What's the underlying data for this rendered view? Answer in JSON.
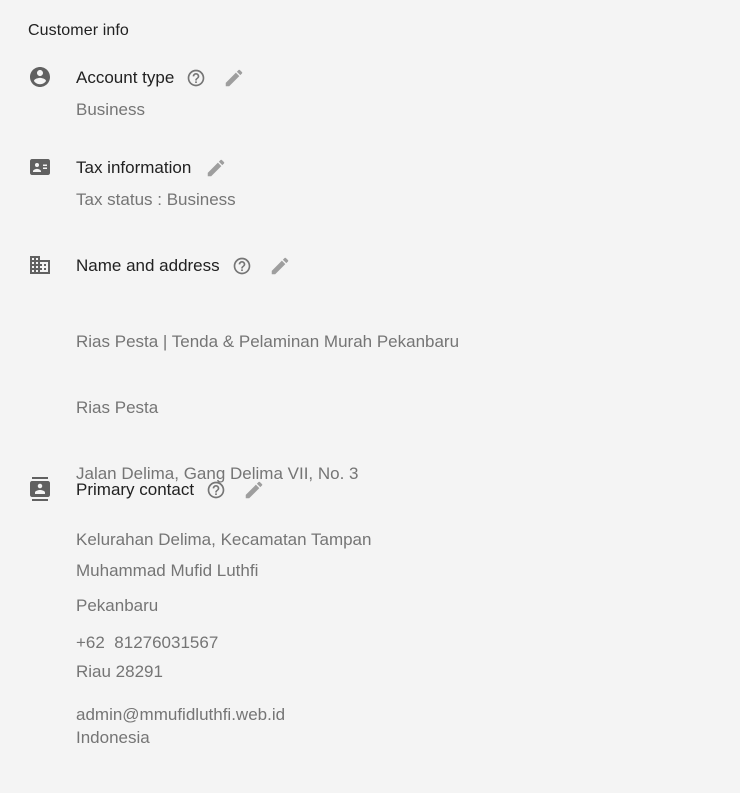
{
  "title": "Customer info",
  "account_type": {
    "icon": "account-circle-icon",
    "label": "Account type",
    "value": "Business"
  },
  "tax_information": {
    "icon": "badge-card-icon",
    "label": "Tax information",
    "value": "Tax status : Business"
  },
  "name_and_address": {
    "icon": "building-icon",
    "label": "Name and address",
    "lines": [
      "Rias Pesta | Tenda & Pelaminan Murah Pekanbaru",
      "Rias Pesta",
      "Jalan Delima, Gang Delima VII, No. 3",
      "Kelurahan Delima, Kecamatan Tampan",
      "Pekanbaru",
      "Riau 28291",
      "Indonesia"
    ]
  },
  "primary_contact": {
    "icon": "contact-card-icon",
    "label": "Primary contact",
    "lines": [
      "Muhammad Mufid Luthfi",
      "+62  81276031567",
      "admin@mmufidluthfi.web.id"
    ]
  }
}
